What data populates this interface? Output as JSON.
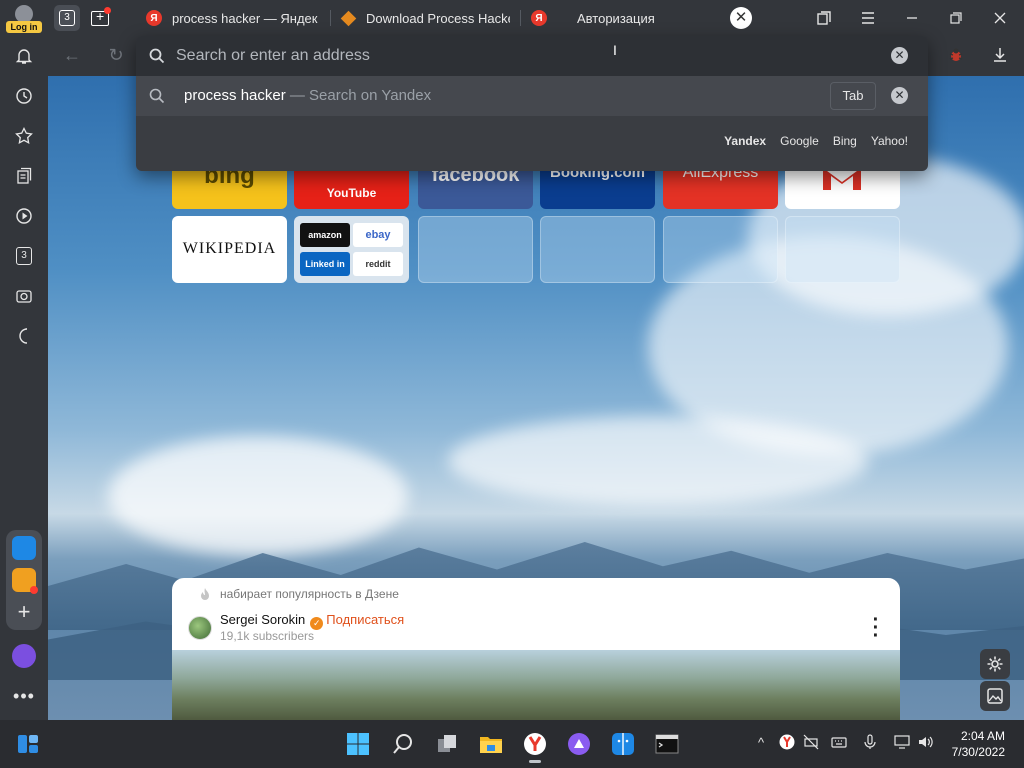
{
  "titlebar": {
    "login_label": "Log in",
    "tab_count": "3",
    "tabs": [
      {
        "title": "process hacker — Яндекс",
        "favicon": "yandex-logo"
      },
      {
        "title": "Download Process Hacker",
        "favicon": "process-hacker-logo"
      },
      {
        "title": "Авторизация",
        "favicon": "yandex-logo"
      }
    ]
  },
  "sidebar": {
    "tabs_badge": "3"
  },
  "omnibox": {
    "placeholder": "Search or enter an address",
    "suggestion_query": "process hacker",
    "suggestion_suffix": " — Search on Yandex",
    "tab_key": "Tab",
    "engines": [
      "Yandex",
      "Google",
      "Bing",
      "Yahoo!"
    ],
    "active_engine": "Yandex"
  },
  "speed_dial": {
    "row1": [
      {
        "label": "bing",
        "bg": "#f5c21b"
      },
      {
        "label": "YouTube",
        "bg": "#e62117"
      },
      {
        "label": "facebook",
        "bg": "#3b5998"
      },
      {
        "label": "Booking.com",
        "bg": "#0a3d8f"
      },
      {
        "label": "AliExpress",
        "bg": "#e43225"
      },
      {
        "label": "",
        "bg": "#ffffff"
      }
    ],
    "wikipedia": "WIKIPEDIA",
    "group": [
      "amazon",
      "ebay",
      "Linked in",
      "reddit"
    ]
  },
  "zen": {
    "trending_label": "набирает популярность в Дзене",
    "author": "Sergei Sorokin",
    "subscribe": "Подписаться",
    "subscribers": "19,1k subscribers"
  },
  "taskbar": {
    "time": "2:04 AM",
    "date": "7/30/2022"
  },
  "colors": {
    "accent": "#f5c842",
    "zen_subscribe": "#e0511c",
    "yandex_red": "#e8392c"
  }
}
